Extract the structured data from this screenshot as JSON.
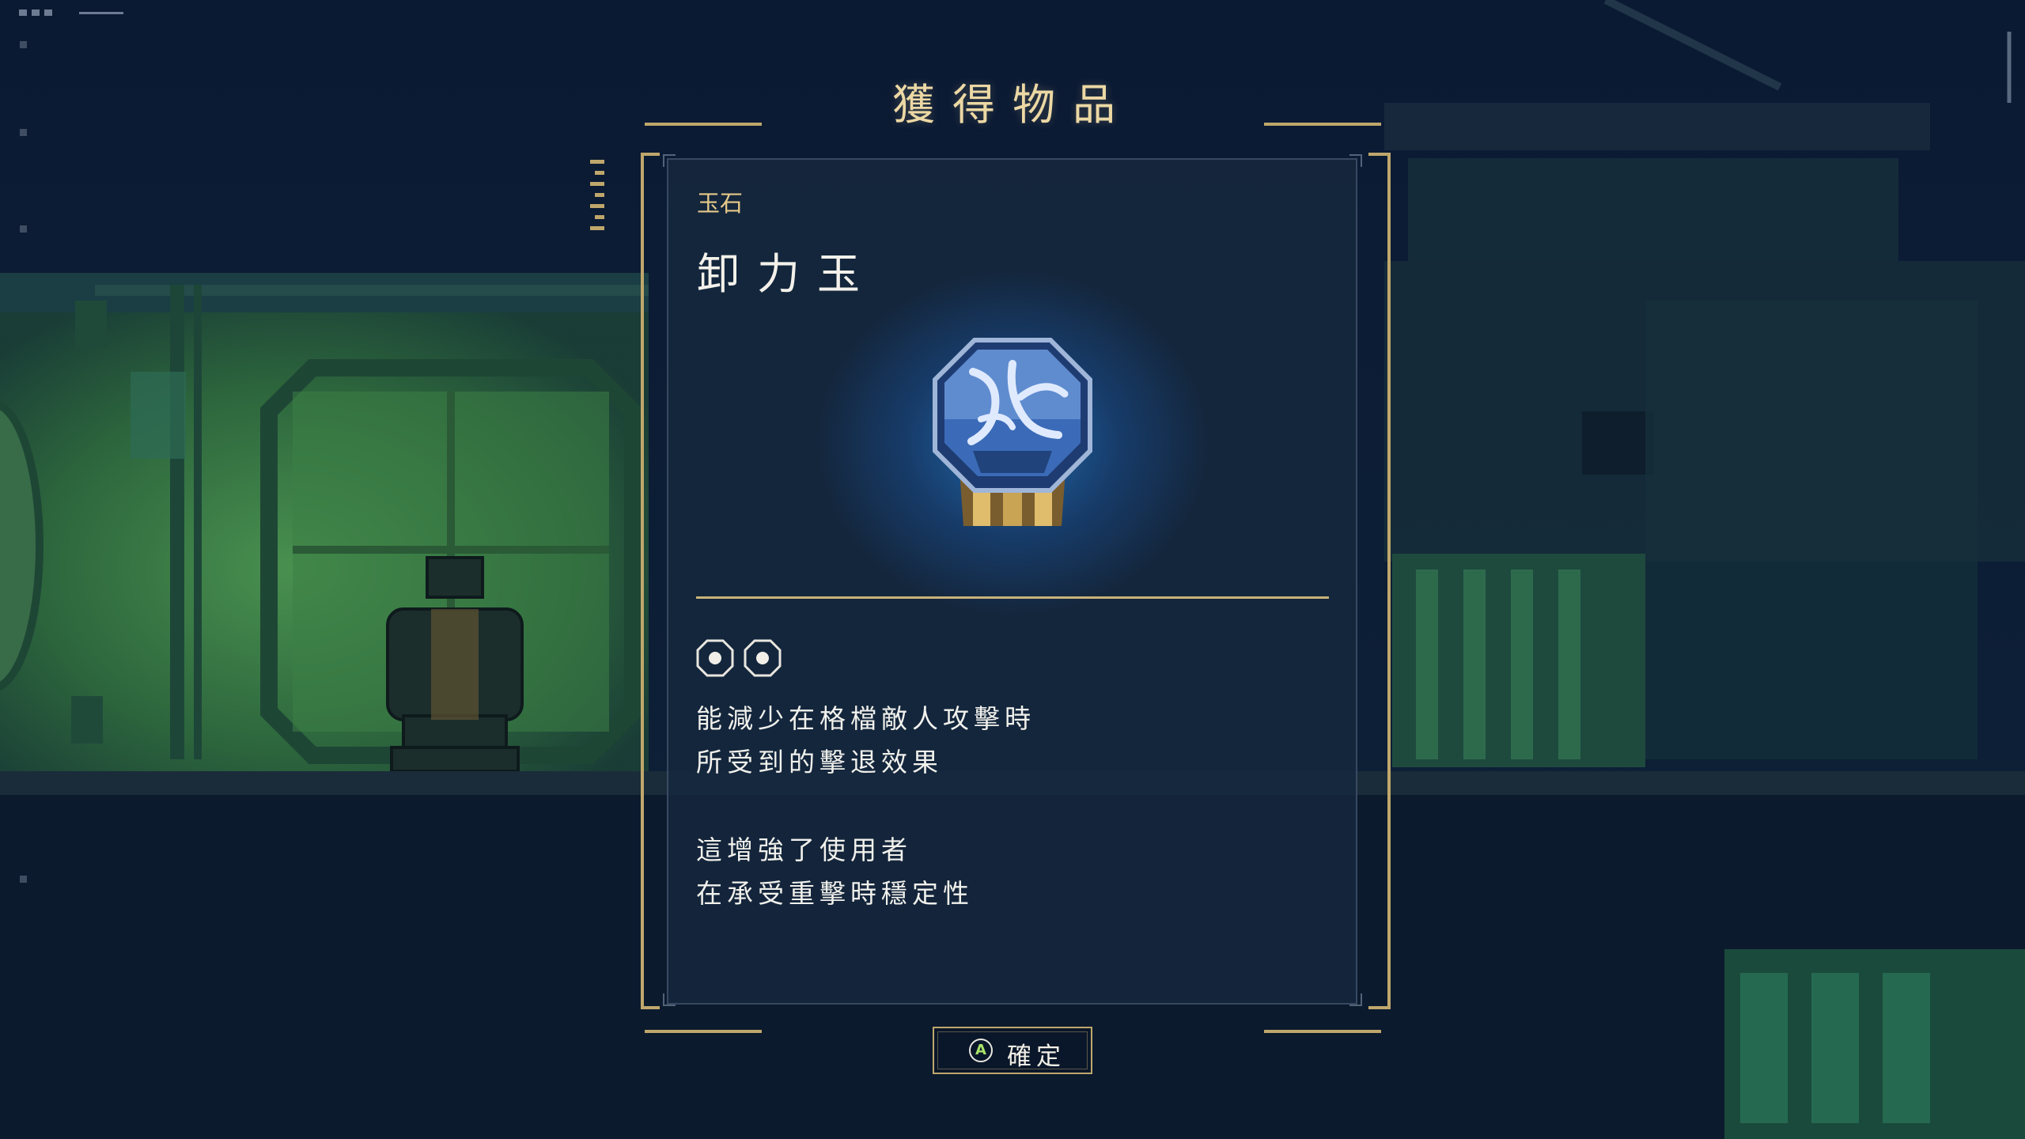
{
  "dialog": {
    "title": "獲得物品",
    "item": {
      "category": "玉石",
      "name": "卸力玉",
      "cost_slots": 2,
      "description": [
        "能減少在格檔敵人攻擊時",
        "所受到的擊退效果",
        "這增強了使用者",
        "在承受重擊時穩定性"
      ]
    },
    "confirm": {
      "button_glyph": "A",
      "label": "確定"
    }
  },
  "colors": {
    "gold_accent": "#bfa76c",
    "title_text": "#ecd8a4",
    "panel_bg": "#16283e",
    "scene_green": "#3f7a43",
    "glow_blue": "#288ce6"
  },
  "icons": {
    "jade": "jade-stone-icon",
    "slot": "jade-slot-icon",
    "confirm_button": "gamepad-a-button-icon"
  }
}
